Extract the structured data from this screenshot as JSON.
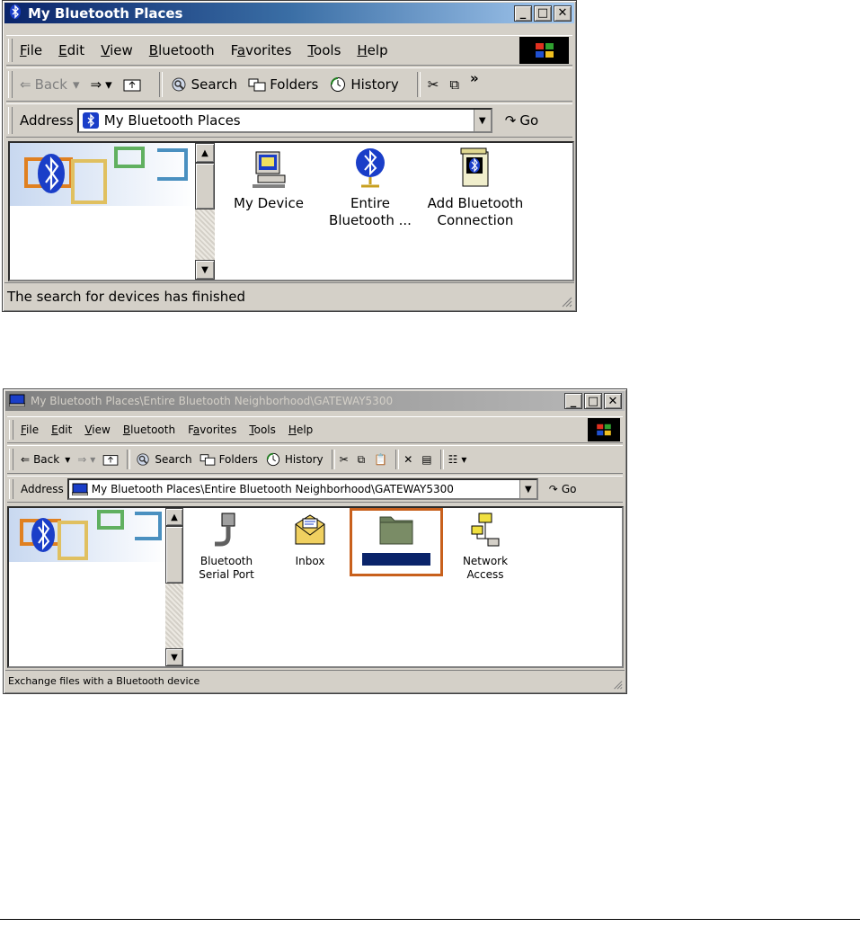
{
  "window1": {
    "title": "My Bluetooth Places",
    "menu": [
      {
        "u": "F",
        "rest": "ile"
      },
      {
        "u": "E",
        "rest": "dit"
      },
      {
        "u": "V",
        "rest": "iew"
      },
      {
        "u": "B",
        "rest": "luetooth"
      },
      {
        "pre": "F",
        "u": "a",
        "rest": "vorites"
      },
      {
        "u": "T",
        "rest": "ools"
      },
      {
        "u": "H",
        "rest": "elp"
      }
    ],
    "toolbar": {
      "back": "Back",
      "search": "Search",
      "folders": "Folders",
      "history": "History",
      "more": "»"
    },
    "address_label": "Address",
    "address_value": "My Bluetooth Places",
    "go": "Go",
    "items": [
      {
        "line1": "My Device",
        "line2": ""
      },
      {
        "line1": "Entire",
        "line2": "Bluetooth ..."
      },
      {
        "line1": "Add Bluetooth",
        "line2": "Connection"
      }
    ],
    "status": "The search for devices has finished"
  },
  "window2": {
    "title": "My Bluetooth Places\\Entire Bluetooth Neighborhood\\GATEWAY5300",
    "menu": [
      {
        "u": "F",
        "rest": "ile"
      },
      {
        "u": "E",
        "rest": "dit"
      },
      {
        "u": "V",
        "rest": "iew"
      },
      {
        "u": "B",
        "rest": "luetooth"
      },
      {
        "pre": "F",
        "u": "a",
        "rest": "vorites"
      },
      {
        "u": "T",
        "rest": "ools"
      },
      {
        "u": "H",
        "rest": "elp"
      }
    ],
    "toolbar": {
      "back": "Back",
      "search": "Search",
      "folders": "Folders",
      "history": "History"
    },
    "address_label": "Address",
    "address_value": "My Bluetooth Places\\Entire Bluetooth Neighborhood\\GATEWAY5300",
    "go": "Go",
    "items": [
      {
        "line1": "Bluetooth",
        "line2": "Serial Port"
      },
      {
        "line1": "Inbox",
        "line2": ""
      },
      {
        "line1": "",
        "line2": ""
      },
      {
        "line1": "Network",
        "line2": "Access"
      }
    ],
    "status": "Exchange files with a Bluetooth device"
  },
  "colors": {
    "title_active": "#0a246a",
    "highlight_border": "#c8601c",
    "bluetooth_blue": "#1a3ec8"
  }
}
